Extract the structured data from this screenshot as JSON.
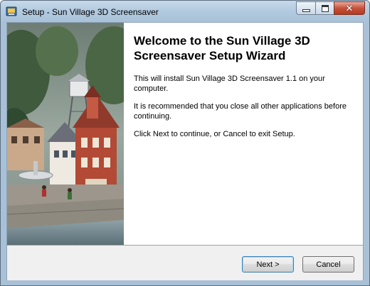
{
  "window": {
    "title": "Setup - Sun Village 3D Screensaver"
  },
  "titlebar": {
    "app_icon": "setup-icon",
    "minimize_icon": "minimize-icon",
    "maximize_icon": "maximize-icon",
    "close_glyph": "✕"
  },
  "wizard": {
    "heading": "Welcome to the Sun Village 3D Screensaver Setup Wizard",
    "paragraph1": "This will install Sun Village 3D Screensaver 1.1 on your computer.",
    "paragraph2": "It is recommended that you close all other applications before continuing.",
    "paragraph3": "Click Next to continue, or Cancel to exit Setup."
  },
  "buttons": {
    "next_label": "Next >",
    "cancel_label": "Cancel"
  },
  "colors": {
    "titlebar": "#b3cbe0",
    "close_button": "#c7523b",
    "default_button_border": "#3c7fb1"
  }
}
